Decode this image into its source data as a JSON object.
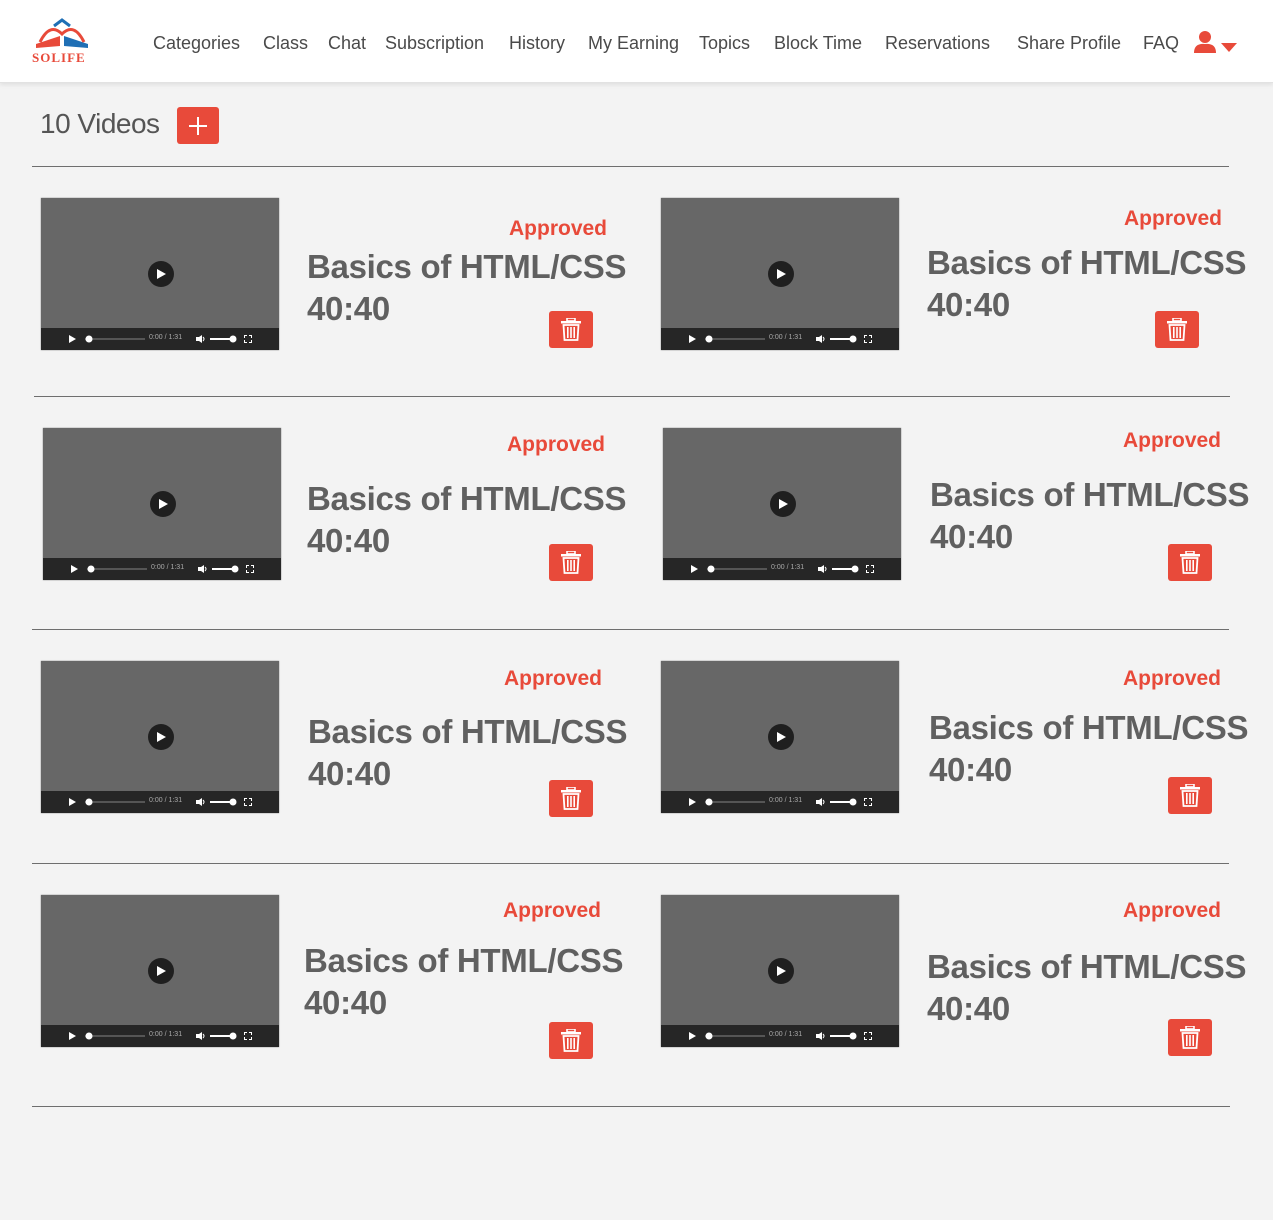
{
  "app": {
    "logo_text": "SOLIFE"
  },
  "nav": {
    "items": [
      {
        "label": "Categories"
      },
      {
        "label": "Class"
      },
      {
        "label": "Chat"
      },
      {
        "label": "Subscription"
      },
      {
        "label": "History"
      },
      {
        "label": "My Earning"
      },
      {
        "label": "Topics"
      },
      {
        "label": "Block Time"
      },
      {
        "label": "Reservations"
      },
      {
        "label": "Share Profile"
      },
      {
        "label": "FAQ"
      }
    ],
    "user_icon": "user-icon",
    "dropdown_icon": "caret-down-icon"
  },
  "toolbar": {
    "title": "10 Videos",
    "add_icon": "plus-icon"
  },
  "player": {
    "time_text": "0:00 / 1:31"
  },
  "videos": [
    {
      "status": "Approved",
      "title": "Basics of HTML/CSS",
      "duration": "40:40"
    },
    {
      "status": "Approved",
      "title": "Basics of HTML/CSS",
      "duration": "40:40"
    },
    {
      "status": "Approved",
      "title": "Basics of HTML/CSS",
      "duration": "40:40"
    },
    {
      "status": "Approved",
      "title": "Basics of HTML/CSS",
      "duration": "40:40"
    },
    {
      "status": "Approved",
      "title": "Basics of HTML/CSS",
      "duration": "40:40"
    },
    {
      "status": "Approved",
      "title": "Basics of HTML/CSS",
      "duration": "40:40"
    },
    {
      "status": "Approved",
      "title": "Basics of HTML/CSS",
      "duration": "40:40"
    },
    {
      "status": "Approved",
      "title": "Basics of HTML/CSS",
      "duration": "40:40"
    }
  ],
  "colors": {
    "accent": "#e84a3a",
    "text": "#606060",
    "background": "#f3f3f3"
  }
}
